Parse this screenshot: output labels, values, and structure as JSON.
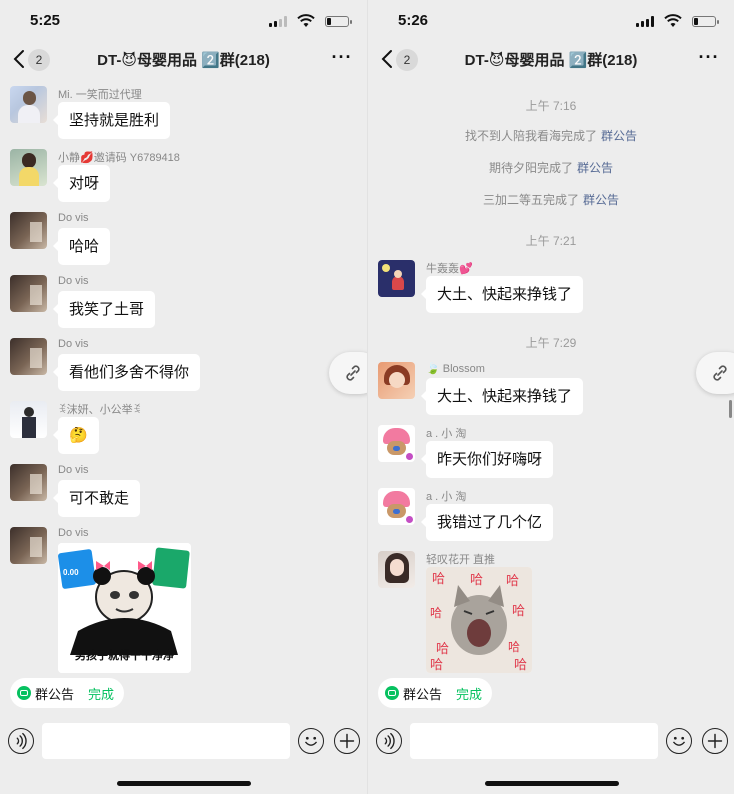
{
  "screens": [
    {
      "status_time": "5:25",
      "nav": {
        "unread": "2",
        "title": "DT-😈母婴用品 2️⃣群(218)",
        "more": "···"
      },
      "messages": [
        {
          "sender": "Mi. 一笑而过代理",
          "text": "坚持就是胜利",
          "avatar": "woman-photo"
        },
        {
          "sender": "小静💋邀请码 Y6789418",
          "text": "对呀",
          "avatar": "woman-photo"
        },
        {
          "sender": "Do vis",
          "text": "哈哈",
          "avatar": "landscape-photo"
        },
        {
          "sender": "Do vis",
          "text": "我笑了土哥",
          "avatar": "landscape-photo"
        },
        {
          "sender": "Do vis",
          "text": "看他们多舍不得你",
          "avatar": "landscape-photo"
        },
        {
          "sender": "ꉂ沫妍、小公举ꉂ",
          "text": "🤔",
          "avatar": "woman-photo"
        },
        {
          "sender": "Do vis",
          "text": "可不敢走",
          "avatar": "landscape-photo"
        },
        {
          "sender": "Do vis",
          "sticker_caption": "男孩子就得干干净净",
          "sticker_card_left": "0.00",
          "avatar": "landscape-photo"
        }
      ],
      "notice_chip": {
        "label": "群公告",
        "status": "完成"
      }
    },
    {
      "status_time": "5:26",
      "nav": {
        "unread": "2",
        "title": "DT-😈母婴用品 2️⃣群(218)",
        "more": "···"
      },
      "events": [
        {
          "timestamp": "上午 7:16"
        },
        {
          "system": "找不到人陪我看海完成了",
          "link": "群公告"
        },
        {
          "system": "期待夕阳完成了",
          "link": "群公告"
        },
        {
          "system": "三加二等五完成了",
          "link": "群公告"
        },
        {
          "timestamp": "上午 7:21"
        },
        {
          "sender": "牛轰轰💕",
          "text": "大土、快起来挣钱了",
          "avatar": "cartoon-night"
        },
        {
          "timestamp": "上午 7:29"
        },
        {
          "sender": "🍃 Blossom",
          "text": "大土、快起来挣钱了",
          "avatar": "woman-photo"
        },
        {
          "sender": "a . 小 淘",
          "text": "昨天你们好嗨呀",
          "avatar": "chopper-cartoon"
        },
        {
          "sender": "a . 小 淘",
          "text": "我错过了几个亿",
          "avatar": "chopper-cartoon"
        },
        {
          "sender": "轻叹花开 直推",
          "sticker_text": "哈",
          "avatar": "woman-photo"
        }
      ],
      "notice_chip": {
        "label": "群公告",
        "status": "完成"
      }
    }
  ],
  "colors": {
    "background": "#ededed",
    "bubble": "#ffffff",
    "accent_green": "#07c160",
    "link_blue": "#576b95"
  },
  "icons": [
    "back-chevron-icon",
    "more-icon",
    "link-icon",
    "voice-icon",
    "emoji-icon",
    "plus-icon",
    "notice-icon"
  ]
}
